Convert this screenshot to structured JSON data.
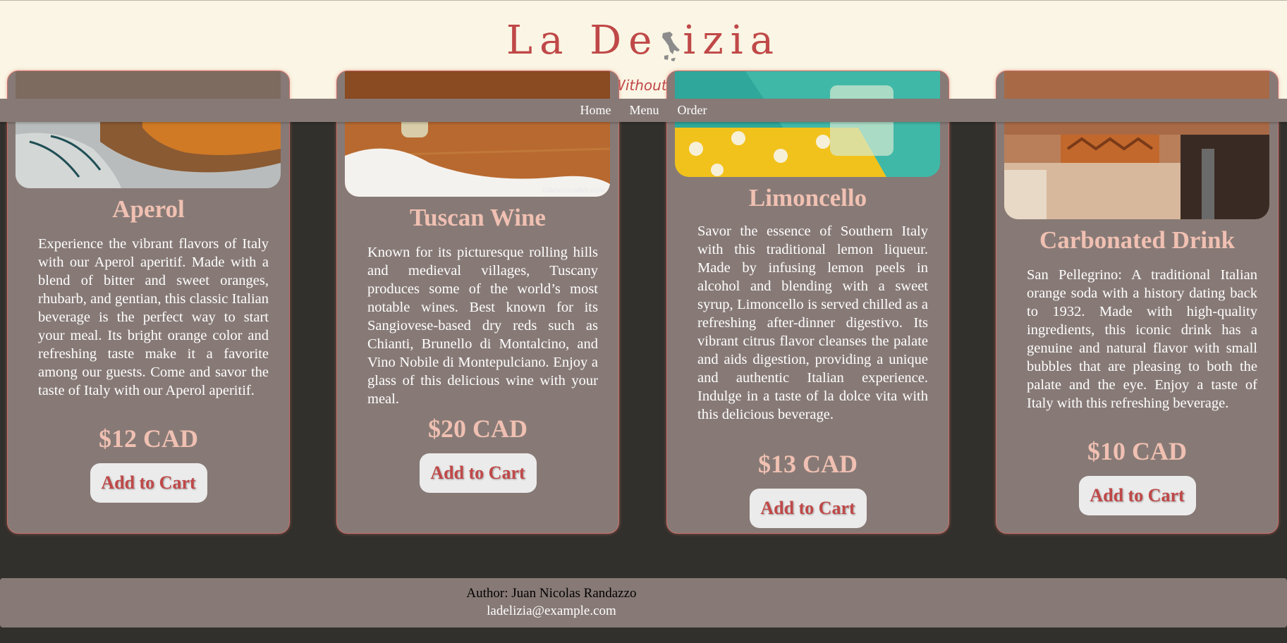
{
  "header": {
    "logo_left": "La De",
    "logo_right": "izia",
    "tagline": "Experience Italy Without Leaving Your City"
  },
  "nav": {
    "items": [
      "Home",
      "Menu",
      "Order"
    ]
  },
  "products": [
    {
      "name": "Aperol",
      "description": "Experience the vibrant flavors of Italy with our Aperol aperitif. Made with a blend of bitter and sweet oranges, rhubarb, and gentian, this classic Italian beverage is the perfect way to start your meal. Its bright orange color and refreshing taste make it a favorite among our guests. Come and savor the taste of Italy with our Aperol aperitif.",
      "price": "$12 CAD",
      "button": "Add to Cart"
    },
    {
      "name": "Tuscan Wine",
      "description": "Known for its picturesque rolling hills and medieval villages, Tuscany produces some of the world’s most notable wines. Best known for its Sangiovese-based dry reds such as Chianti, Brunello di Montalcino, and Vino Nobile di Montepulciano. Enjoy a glass of this delicious wine with your meal.",
      "price": "$20 CAD",
      "button": "Add to Cart",
      "photo_watermark": "GlamorousBite.com"
    },
    {
      "name": "Limoncello",
      "description": "Savor the essence of Southern Italy with this traditional lemon liqueur. Made by infusing lemon peels in alcohol and blending with a sweet syrup, Limoncello is served chilled as a refreshing after-dinner digestivo. Its vibrant citrus flavor cleanses the palate and aids digestion, providing a unique and authentic Italian experience. Indulge in a taste of la dolce vita with this delicious beverage.",
      "price": "$13 CAD",
      "button": "Add to Cart"
    },
    {
      "name": "Carbonated Drink",
      "description": "San Pellegrino: A traditional Italian orange soda with a history dating back to 1932. Made with high-quality ingredients, this iconic drink has a genuine and natural flavor with small bubbles that are pleasing to both the palate and the eye. Enjoy a taste of Italy with this refreshing beverage.",
      "price": "$10 CAD",
      "button": "Add to Cart"
    }
  ],
  "footer": {
    "author": "Author: Juan Nicolas Randazzo",
    "email": "ladelizia@example.com"
  },
  "colors": {
    "page_background": "#32302c",
    "header_background": "#faf5e4",
    "brand_red": "#c04848",
    "card_background": "#877a76",
    "heading_pink": "#f0c0b2",
    "button_background": "#ecebeb"
  }
}
